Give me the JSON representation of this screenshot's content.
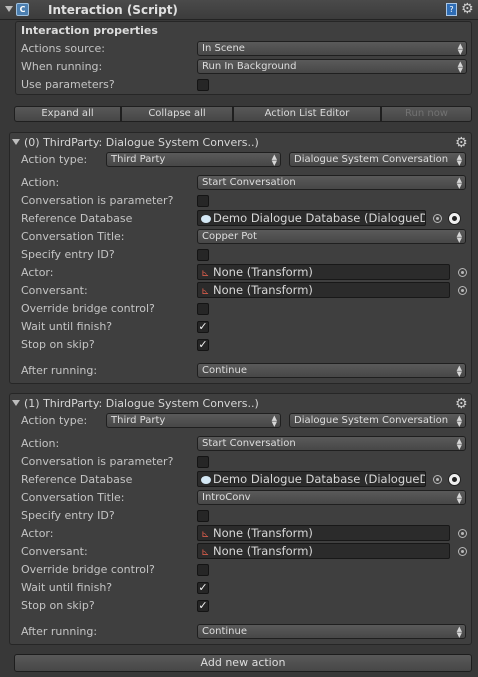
{
  "header": {
    "title": "Interaction (Script)"
  },
  "props": {
    "title": "Interaction properties",
    "actions_source_label": "Actions source:",
    "actions_source_value": "In Scene",
    "when_running_label": "When running:",
    "when_running_value": "Run In Background",
    "use_params_label": "Use parameters?"
  },
  "toolbar": {
    "expand": "Expand all",
    "collapse": "Collapse all",
    "editor": "Action List Editor",
    "run": "Run now"
  },
  "actions": [
    {
      "title": "(0) ThirdParty: Dialogue System Convers..)",
      "type_label": "Action type:",
      "type_value": "Third Party",
      "subtype_value": "Dialogue System Conversation",
      "action_label": "Action:",
      "action_value": "Start Conversation",
      "conv_param_label": "Conversation is parameter?",
      "refdb_label": "Reference Database",
      "refdb_value": "Demo Dialogue Database (DialogueD",
      "conv_title_label": "Conversation Title:",
      "conv_title_value": "Copper Pot",
      "entry_label": "Specify entry ID?",
      "actor_label": "Actor:",
      "actor_value": "None (Transform)",
      "conversant_label": "Conversant:",
      "conversant_value": "None (Transform)",
      "override_label": "Override bridge control?",
      "wait_label": "Wait until finish?",
      "wait_checked": "✓",
      "stop_label": "Stop on skip?",
      "stop_checked": "✓",
      "after_label": "After running:",
      "after_value": "Continue"
    },
    {
      "title": "(1) ThirdParty: Dialogue System Convers..)",
      "type_label": "Action type:",
      "type_value": "Third Party",
      "subtype_value": "Dialogue System Conversation",
      "action_label": "Action:",
      "action_value": "Start Conversation",
      "conv_param_label": "Conversation is parameter?",
      "refdb_label": "Reference Database",
      "refdb_value": "Demo Dialogue Database (DialogueD",
      "conv_title_label": "Conversation Title:",
      "conv_title_value": "IntroConv",
      "entry_label": "Specify entry ID?",
      "actor_label": "Actor:",
      "actor_value": "None (Transform)",
      "conversant_label": "Conversant:",
      "conversant_value": "None (Transform)",
      "override_label": "Override bridge control?",
      "wait_label": "Wait until finish?",
      "wait_checked": "✓",
      "stop_label": "Stop on skip?",
      "stop_checked": "✓",
      "after_label": "After running:",
      "after_value": "Continue"
    }
  ],
  "add_action": "Add new action"
}
